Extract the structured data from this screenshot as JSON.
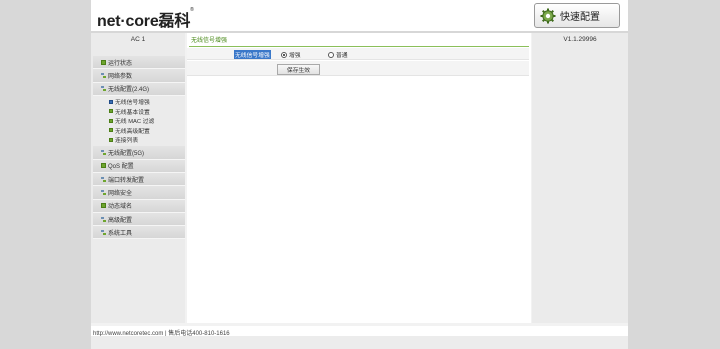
{
  "header": {
    "brand_en": "net·core",
    "brand_cn": "磊科",
    "quick_setup_label": "快速配置"
  },
  "sidebar": {
    "model": "AC 1",
    "menu": [
      {
        "label": "运行状态"
      },
      {
        "label": "网络参数"
      },
      {
        "label": "无线配置(2.4G)",
        "expanded": true,
        "children": [
          {
            "label": "无线信号增强",
            "active": true
          },
          {
            "label": "无线基本设置"
          },
          {
            "label": "无线 MAC 过滤"
          },
          {
            "label": "无线高级配置"
          },
          {
            "label": "连接列表"
          }
        ]
      },
      {
        "label": "无线配置(5G)"
      },
      {
        "label": "QoS 配置"
      },
      {
        "label": "端口转发配置"
      },
      {
        "label": "网络安全"
      },
      {
        "label": "动态域名"
      },
      {
        "label": "高级配置"
      },
      {
        "label": "系统工具"
      }
    ]
  },
  "content": {
    "panel_title": "无线信号增强",
    "field_label": "无线信号增强",
    "options": [
      {
        "label": "增强",
        "selected": true
      },
      {
        "label": "普通",
        "selected": false
      }
    ],
    "save_label": "保存生效"
  },
  "rightcol": {
    "version": "V1.1.29996"
  },
  "footer": {
    "text": "http://www.netcoretec.com | 售后电话400-810-1616"
  },
  "colors": {
    "accent_green": "#6ea52e",
    "selection_blue": "#3a78c9"
  }
}
